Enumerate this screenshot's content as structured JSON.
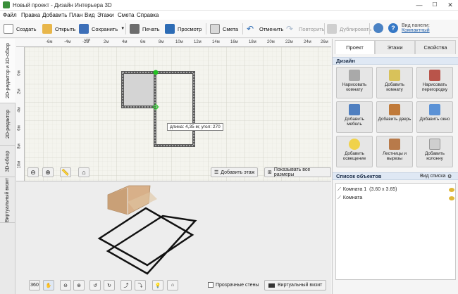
{
  "window": {
    "title": "Новый проект - Дизайн Интерьера 3D",
    "minimize": "—",
    "maximize": "☐",
    "close": "✕"
  },
  "menu": [
    "Файл",
    "Правка",
    "Добавить",
    "План",
    "Вид",
    "Этажи",
    "Смета",
    "Справка"
  ],
  "toolbar": {
    "create": "Создать",
    "open": "Открыть",
    "save": "Сохранить",
    "print": "Печать",
    "preview": "Просмотр",
    "estimate": "Смета",
    "undo": "Отменить",
    "redo": "Повторить",
    "duplicate": "Дублировать",
    "panel_view_label": "Вид панели:",
    "panel_view_value": "Компактный"
  },
  "left_tabs": [
    "2D-редактор и 3D-обзор",
    "2D-редактор",
    "3D-обзор",
    "Виртуальный визит"
  ],
  "plan": {
    "ruler_top": [
      "-6м",
      "-4м",
      "-2м",
      "0м",
      "2м",
      "4м",
      "6м",
      "8м",
      "10м",
      "12м",
      "14м",
      "16м",
      "18м",
      "20м",
      "22м",
      "24м",
      "26м"
    ],
    "ruler_top_zero": "0M",
    "ruler_left": [
      "0м",
      "2м",
      "4м",
      "6м",
      "8м",
      "10м"
    ],
    "tooltip": "длина: 4,35 м; угол: 270",
    "add_floor": "Добавить этаж",
    "show_sizes": "Показывать все размеры"
  },
  "view3d": {
    "btn_360": "360",
    "transparent_walls": "Прозрачные стены",
    "virtual_visit": "Виртуальный визит"
  },
  "right_panel": {
    "tabs": [
      "Проект",
      "Этажи",
      "Свойства"
    ],
    "design_title": "Дизайн",
    "design_buttons": [
      {
        "label": "Нарисовать комнату"
      },
      {
        "label": "Добавить комнату"
      },
      {
        "label": "Нарисовать перегородку"
      },
      {
        "label": "Добавить мебель"
      },
      {
        "label": "Добавить дверь"
      },
      {
        "label": "Добавить окно"
      },
      {
        "label": "Добавить освещение"
      },
      {
        "label": "Лестницы и вырезы"
      },
      {
        "label": "Добавить колонну"
      }
    ],
    "objects_title": "Список объектов",
    "objects_view": "Вид списка",
    "objects": [
      {
        "name": "Комната 1",
        "size": "(3.60 x 3.65)"
      },
      {
        "name": "Комната",
        "size": ""
      }
    ]
  },
  "colors": {
    "accent": "#1a5aa6",
    "green_handle": "#22c222",
    "wall": "#555555",
    "section_head": "#dfe8f4"
  }
}
